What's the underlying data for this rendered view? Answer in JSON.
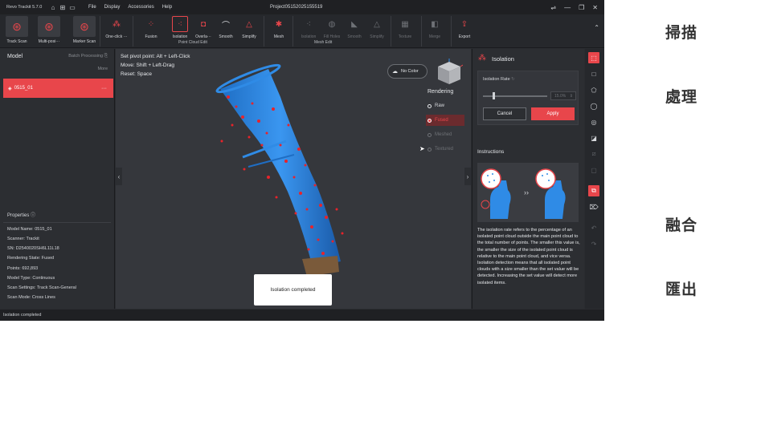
{
  "titlebar": {
    "app_name": "Revo Trackit 5.7.0",
    "menus": [
      "File",
      "Display",
      "Accessories",
      "Help"
    ],
    "project": "Project05152025155519"
  },
  "toolbar": {
    "scan_tools": [
      {
        "label": "Track Scan"
      },
      {
        "label": "Multi-posi···"
      },
      {
        "label": "Marker Scan"
      }
    ],
    "one_click": "One-click ···",
    "point_cloud_tools": [
      "Fusion",
      "Isolation",
      "Overla···",
      "Smooth",
      "Simplify"
    ],
    "point_cloud_group": "Point Cloud Edit",
    "mesh_label": "Mesh",
    "mesh_tools": [
      "Isolation",
      "Fill Holes",
      "Smooth",
      "Simplify"
    ],
    "mesh_group": "Mesh Edit",
    "texture": "Texture",
    "merge": "Merge",
    "export": "Export"
  },
  "left_panel": {
    "title": "Model",
    "batch": "Batch Processing",
    "more": "More",
    "model_name": "0515_01",
    "properties_title": "Properties",
    "properties": [
      "Model Name:  0515_01",
      "Scanner:  Trackit",
      "SN:  D2540020SH6L11L18",
      "Rendering State:  Fused",
      "Points:  692,893",
      "Model Type:  Continuous",
      "Scan Settings:  Track Scan-General",
      "Scan Mode:  Cross Lines"
    ]
  },
  "viewport": {
    "hints": [
      "Set pivot point: Alt + Left-Click",
      "Move: Shift + Left-Drag",
      "Reset: Space"
    ],
    "no_color": "No Color",
    "rendering_title": "Rendering",
    "rendering_options": [
      "Raw",
      "Fused",
      "Meshed",
      "Textured"
    ],
    "toast": "Isolation completed"
  },
  "right_panel": {
    "title": "Isolation",
    "rate_label": "Isolation Rate",
    "rate_value": "15.0%",
    "cancel": "Cancel",
    "apply": "Apply",
    "instructions_title": "Instructions",
    "instructions_text": "The isolation rate refers to the percentage of an isolated point cloud outside the main point cloud to the total number of points. The smaller this value is, the smaller the size of the isolated point cloud is relative to the main point cloud, and vice versa. Isolation detection means that all isolated point clouds with a size smaller than the set value will be detected. Increasing the set value will detect more isolated items."
  },
  "statusbar": {
    "text": "Isolation completed"
  },
  "side_labels": [
    "掃描",
    "處理",
    "融合",
    "匯出"
  ],
  "colors": {
    "accent": "#e8464b",
    "model_blue": "#2f8be6"
  }
}
